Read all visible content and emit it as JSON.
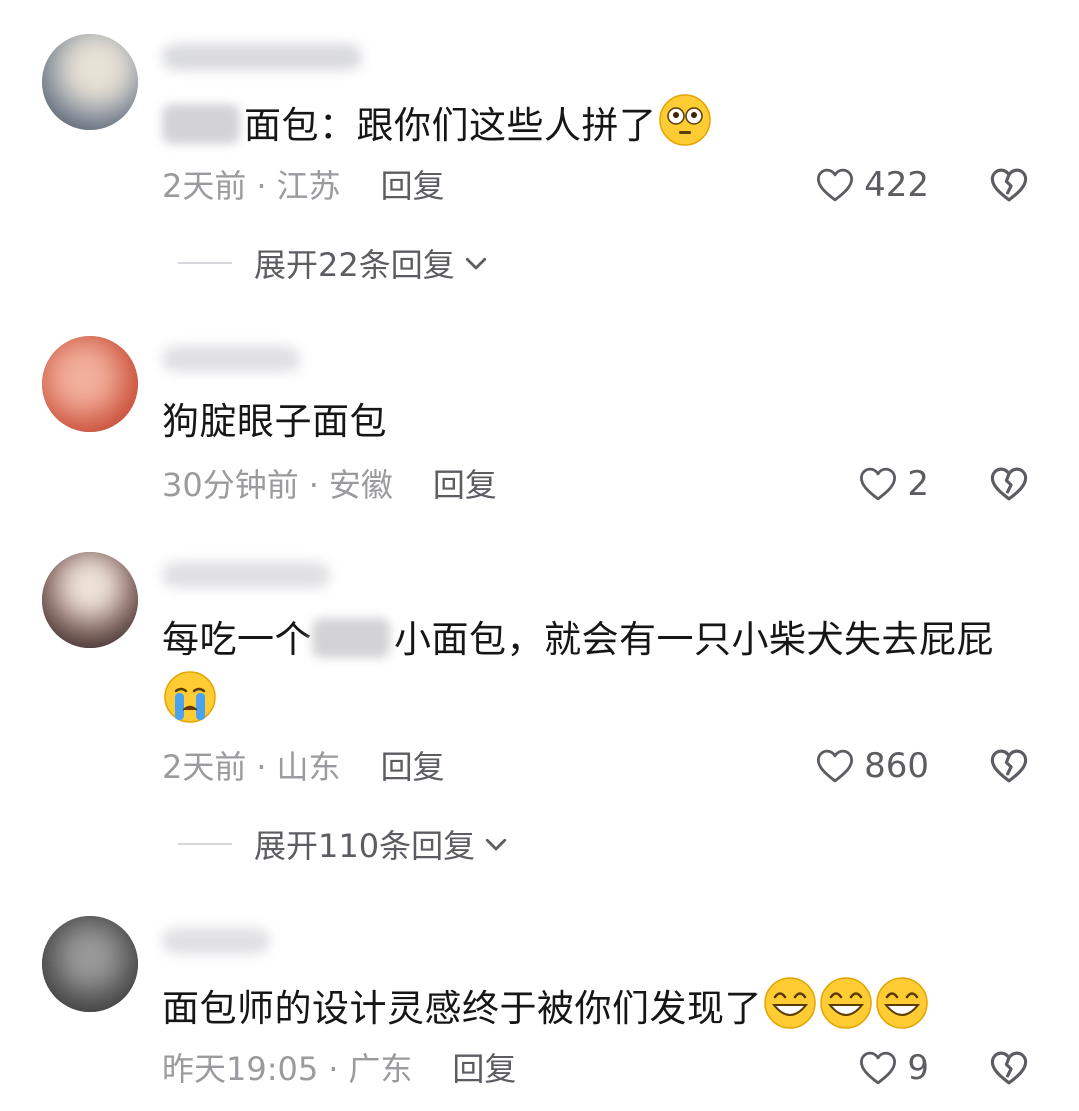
{
  "comments": [
    {
      "text_after_blur": "面包：跟你们这些人拼了",
      "emoji": "flushed-face-icon",
      "time": "2天前",
      "location": "江苏",
      "reply_label": "回复",
      "likes": "422",
      "expand_label": "展开22条回复"
    },
    {
      "text": "狗腚眼子面包",
      "time": "30分钟前",
      "location": "安徽",
      "reply_label": "回复",
      "likes": "2"
    },
    {
      "text_before_blur": "每吃一个",
      "text_after_blur": "小面包，就会有一只小柴犬失去屁屁",
      "emoji": "crying-face-icon",
      "time": "2天前",
      "location": "山东",
      "reply_label": "回复",
      "likes": "860",
      "expand_label": "展开110条回复"
    },
    {
      "text": "面包师的设计灵感终于被你们发现了",
      "emoji": "grinning-face-icon",
      "time": "昨天19:05",
      "location": "广东",
      "reply_label": "回复",
      "likes": "9"
    }
  ],
  "separator": "·",
  "colors": {
    "text": "#161616",
    "meta": "#9a9a9f",
    "action": "#5c5c62",
    "emoji": "#ffcc33"
  }
}
